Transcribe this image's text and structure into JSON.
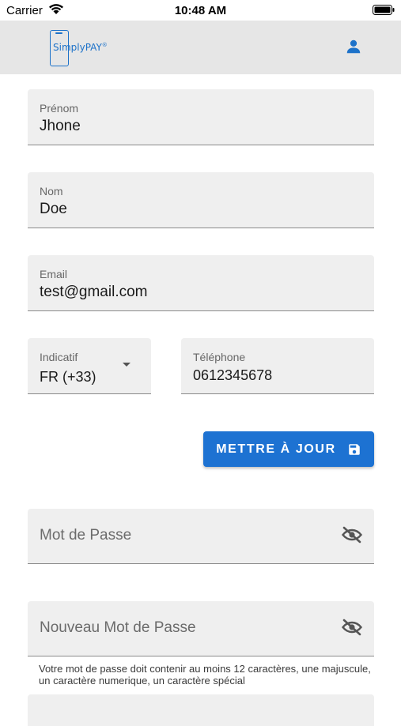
{
  "status_bar": {
    "carrier": "Carrier",
    "time": "10:48 AM"
  },
  "header": {
    "logo_simply": "Simply",
    "logo_pay": "PAY",
    "logo_reg": "®",
    "profile_icon": "person-icon",
    "accent": "#1d72c9"
  },
  "form": {
    "first_name": {
      "label": "Prénom",
      "value": "Jhone"
    },
    "last_name": {
      "label": "Nom",
      "value": "Doe"
    },
    "email": {
      "label": "Email",
      "value": "test@gmail.com"
    },
    "dial_code": {
      "label": "Indicatif",
      "value": "FR (+33)"
    },
    "phone": {
      "label": "Téléphone",
      "value": "0612345678"
    },
    "update_button": "METTRE À JOUR"
  },
  "password": {
    "current": {
      "placeholder": "Mot de Passe"
    },
    "new": {
      "placeholder": "Nouveau Mot de Passe"
    },
    "helper": "Votre mot de passe doit contenir au moins 12 caractères, une majuscule, un caractère numerique, un caractère spécial"
  },
  "colors": {
    "primary_button": "#1d72d2",
    "field_background": "#efefef",
    "header_background": "#e6e6e6"
  }
}
